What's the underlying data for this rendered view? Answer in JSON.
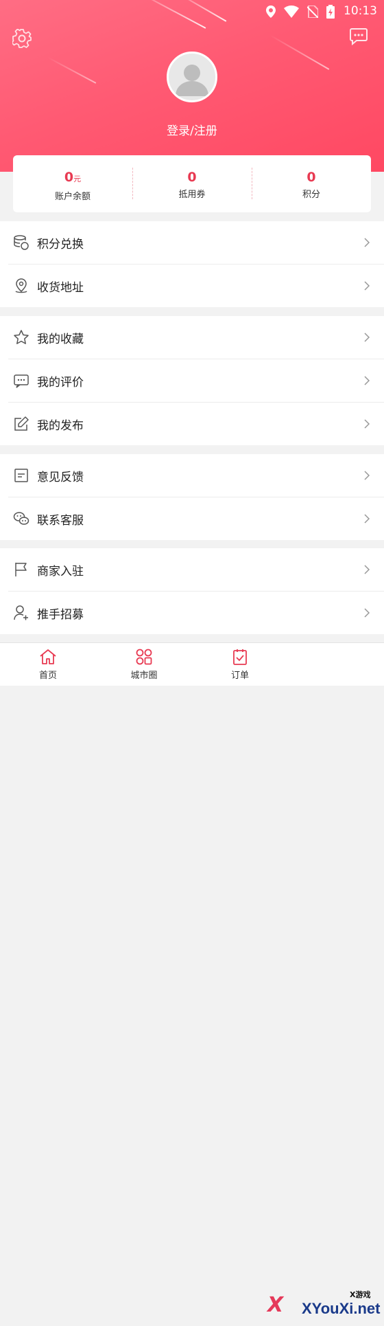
{
  "status": {
    "time": "10:13"
  },
  "header": {
    "login_label": "登录/注册"
  },
  "stats": [
    {
      "value": "0",
      "unit": "元",
      "label": "账户余额"
    },
    {
      "value": "0",
      "unit": "",
      "label": "抵用券"
    },
    {
      "value": "0",
      "unit": "",
      "label": "积分"
    }
  ],
  "menu": {
    "points_exchange": "积分兑换",
    "address": "收货地址",
    "favorites": "我的收藏",
    "reviews": "我的评价",
    "posts": "我的发布",
    "feedback": "意见反馈",
    "support": "联系客服",
    "merchant": "商家入驻",
    "recruit": "推手招募"
  },
  "tabs": {
    "home": "首页",
    "city": "城市圈",
    "orders": "订单"
  },
  "watermark": {
    "main": "XYouXi.net",
    "small": "X游戏",
    "x": "X"
  },
  "colors": {
    "accent": "#ff5a73",
    "value": "#e83a52"
  }
}
